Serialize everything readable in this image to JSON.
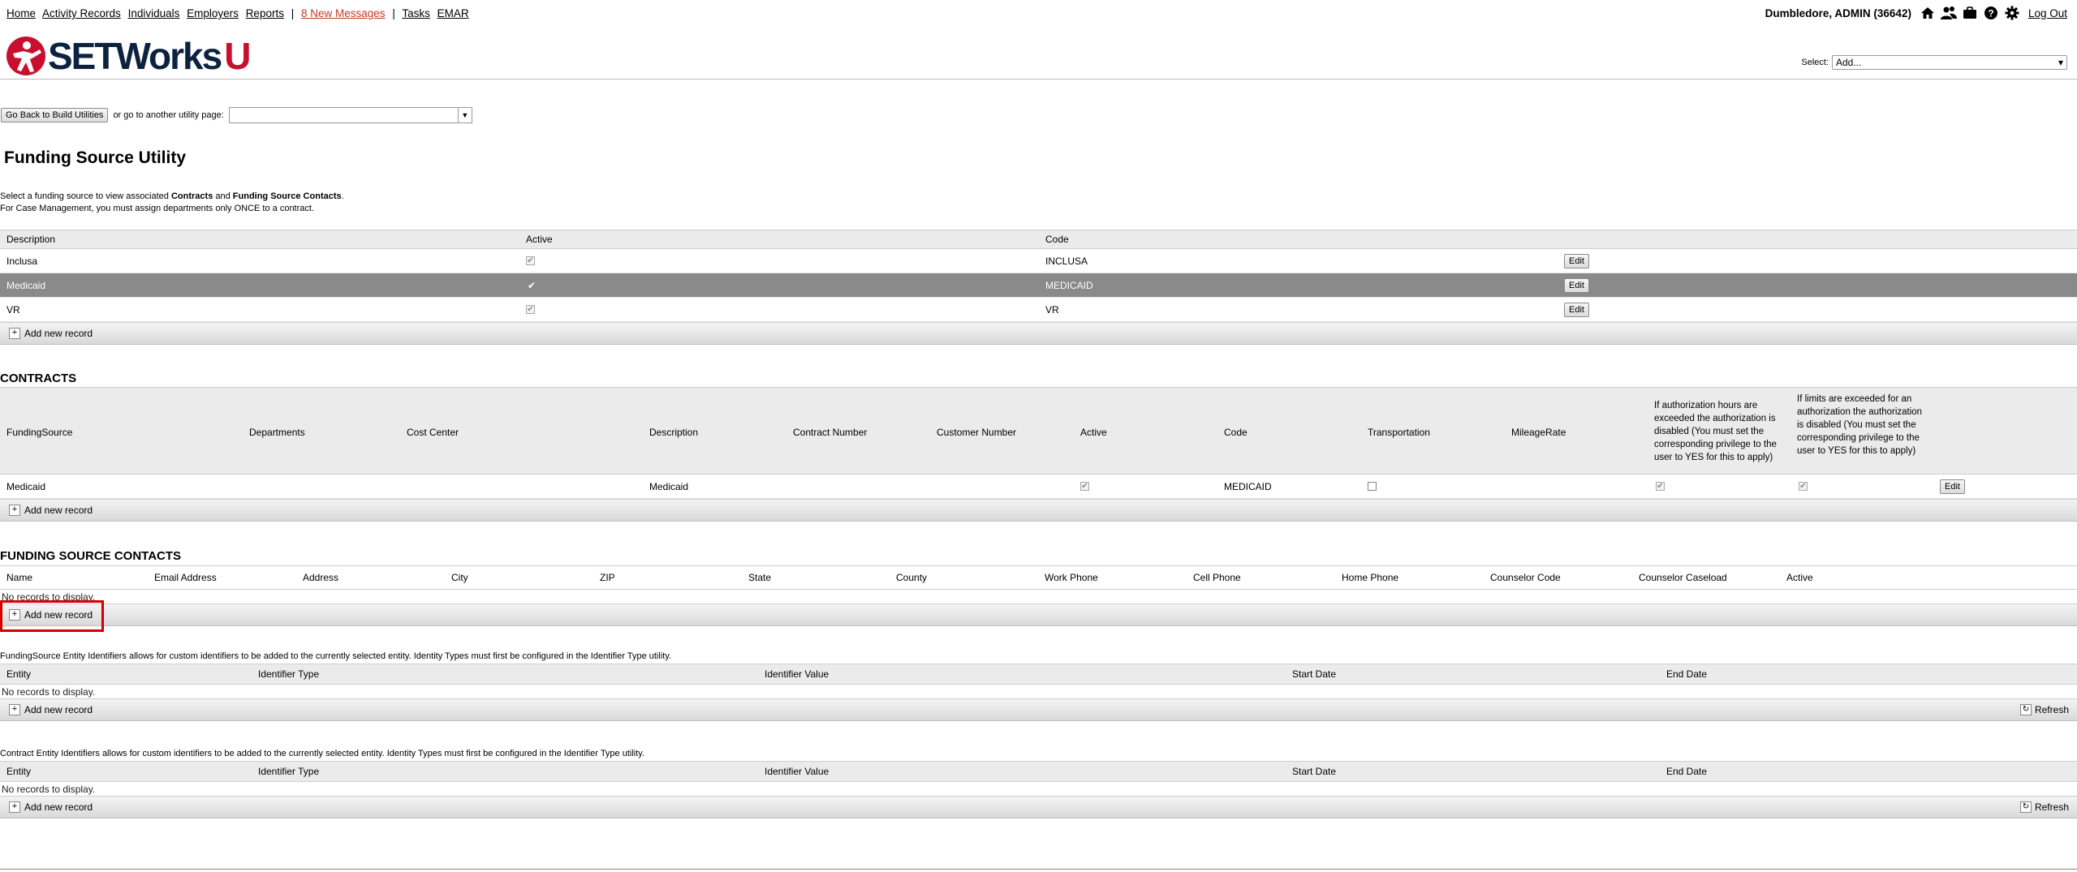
{
  "nav": {
    "home": "Home",
    "activity_records": "Activity Records",
    "individuals": "Individuals",
    "employers": "Employers",
    "reports": "Reports",
    "sep1": "|",
    "messages": "8 New Messages",
    "sep2": "|",
    "tasks": "Tasks",
    "emar": "EMAR"
  },
  "user": {
    "name": "Dumbledore, ADMIN (36642)",
    "logout": "Log Out",
    "icons": [
      "home-icon",
      "users-icon",
      "briefcase-icon",
      "help-icon",
      "gear-icon"
    ]
  },
  "logo": {
    "text": "SETWorks",
    "suffix": "U",
    "colors": {
      "brand": "#0d2240",
      "accent": "#c8102e"
    }
  },
  "select": {
    "label": "Select:",
    "value": "Add..."
  },
  "util": {
    "back_button": "Go Back to Build Utilities",
    "or_text": "or go to another utility page:",
    "combo_value": ""
  },
  "page_title": "Funding Source Utility",
  "intro": {
    "line1_a": "Select a funding source to view associated ",
    "line1_b": "Contracts",
    "line1_c": " and ",
    "line1_d": "Funding Source Contacts",
    "line1_e": ".",
    "line2": "For Case Management, you must assign departments only ONCE to a contract."
  },
  "funding_sources": {
    "columns": [
      "Description",
      "Active",
      "Code"
    ],
    "rows": [
      {
        "description": "Inclusa",
        "active": true,
        "code": "INCLUSA",
        "edit": "Edit"
      },
      {
        "description": "Medicaid",
        "active": true,
        "code": "MEDICAID",
        "edit": "Edit"
      },
      {
        "description": "VR",
        "active": true,
        "code": "VR",
        "edit": "Edit"
      }
    ],
    "add": "Add new record"
  },
  "contracts": {
    "title": "CONTRACTS",
    "columns": [
      "FundingSource",
      "Departments",
      "Cost Center",
      "Description",
      "Contract Number",
      "Customer Number",
      "Active",
      "Code",
      "Transportation",
      "MileageRate",
      "If authorization hours are exceeded the authorization is disabled (You must set the corresponding privilege to the user to YES for this to apply)",
      "If limits are exceeded for an authorization the authorization is disabled (You must set the corresponding privilege to the user to YES for this to apply)"
    ],
    "row": {
      "funding_source": "Medicaid",
      "description": "Medicaid",
      "code": "MEDICAID",
      "edit": "Edit"
    },
    "add": "Add new record"
  },
  "contacts": {
    "title": "FUNDING SOURCE CONTACTS",
    "columns": [
      "Name",
      "Email Address",
      "Address",
      "City",
      "ZIP",
      "State",
      "County",
      "Work Phone",
      "Cell Phone",
      "Home Phone",
      "Counselor Code",
      "Counselor Caseload",
      "Active"
    ],
    "empty": "No records to display.",
    "add": "Add new record"
  },
  "fs_identifiers": {
    "note": "FundingSource Entity Identifiers allows for custom identifiers to be added to the currently selected entity. Identity Types must first be configured in the Identifier Type utility.",
    "columns": [
      "Entity",
      "Identifier Type",
      "Identifier Value",
      "Start Date",
      "End Date"
    ],
    "empty": "No records to display.",
    "add": "Add new record",
    "refresh": "Refresh"
  },
  "contract_identifiers": {
    "note": "Contract Entity Identifiers allows for custom identifiers to be added to the currently selected entity. Identity Types must first be configured in the Identifier Type utility.",
    "columns": [
      "Entity",
      "Identifier Type",
      "Identifier Value",
      "Start Date",
      "End Date"
    ],
    "empty": "No records to display.",
    "add": "Add new record",
    "refresh": "Refresh"
  }
}
